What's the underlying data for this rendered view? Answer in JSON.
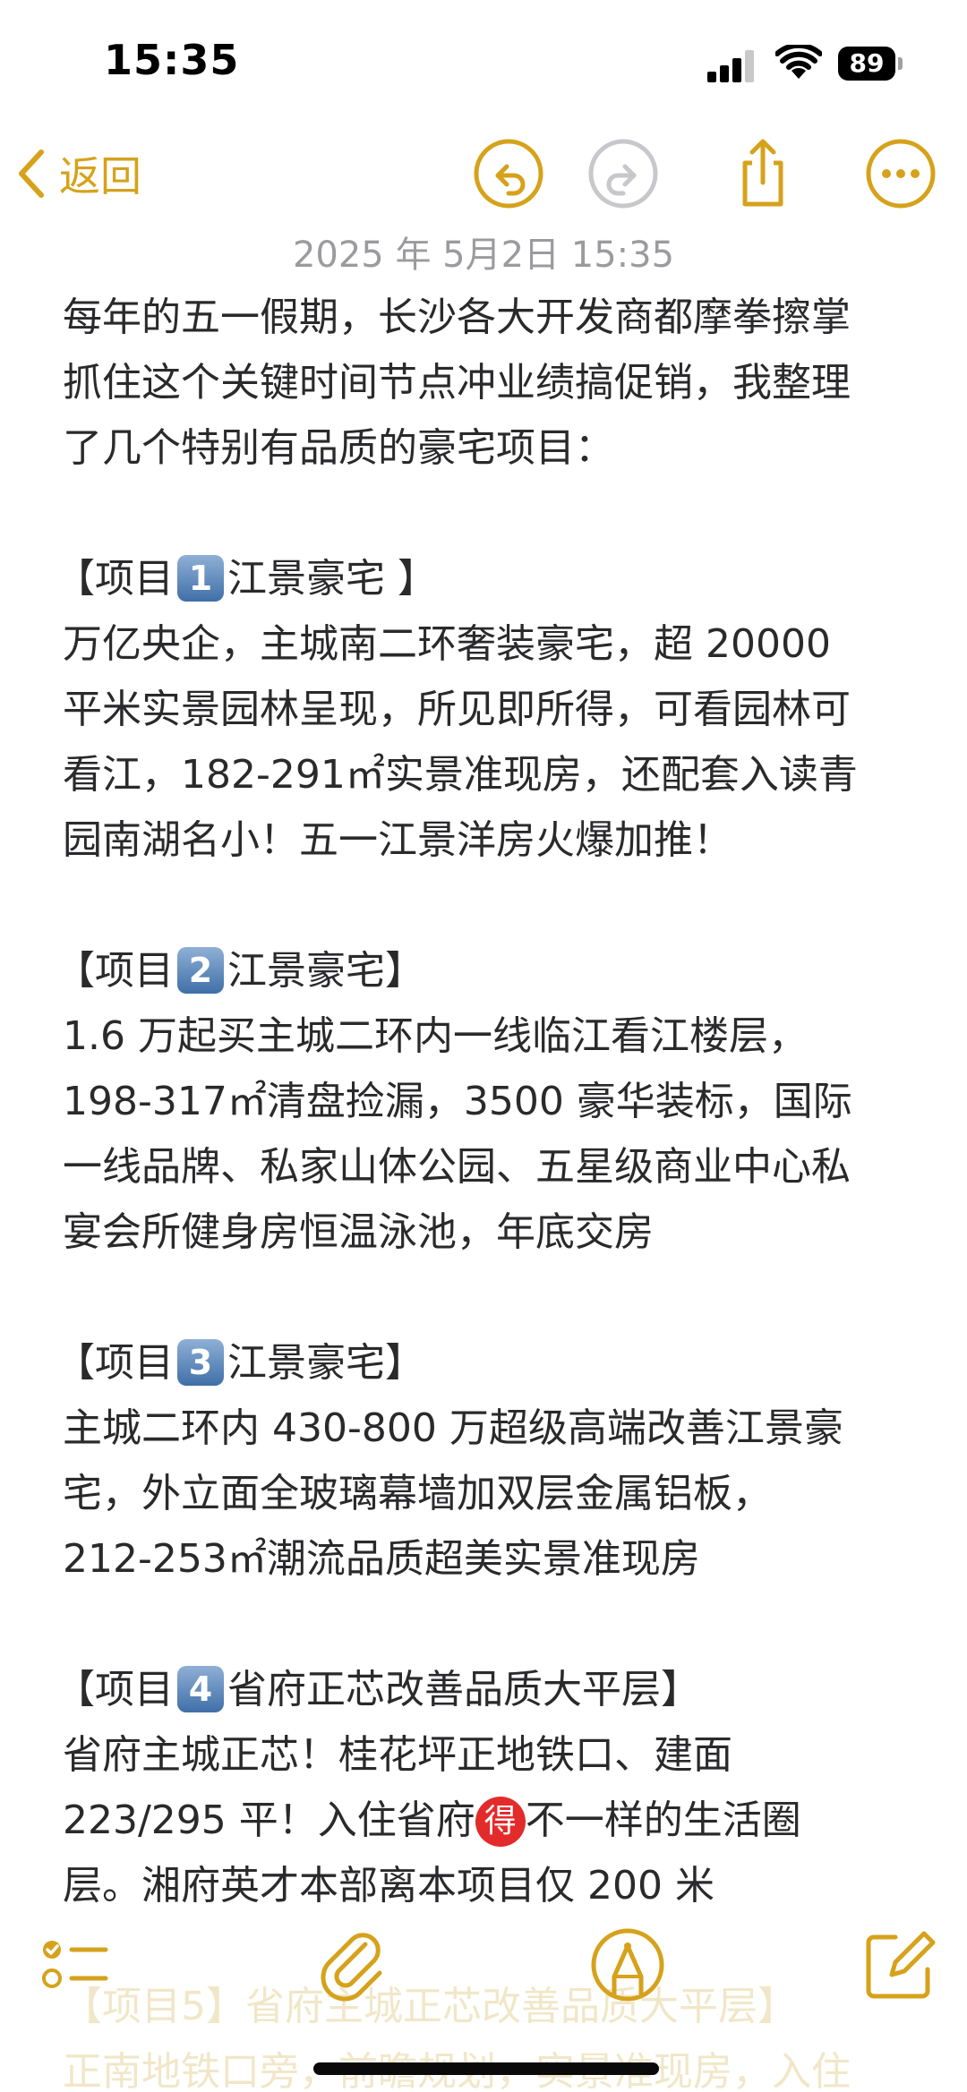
{
  "status_bar": {
    "time": "15:35",
    "battery_level": "89",
    "icons": [
      "signal-icon",
      "wifi-icon",
      "battery-icon"
    ]
  },
  "nav": {
    "back_label": "返回",
    "icons": [
      "undo-icon",
      "redo-icon",
      "share-icon",
      "more-icon"
    ]
  },
  "note": {
    "date": "2025 年 5月2日 15:35",
    "lines": {
      "l1": "每年的五一假期，长沙各大开发商都摩拳擦掌",
      "l2": "抓住这个关键时间节点冲业绩搞促销，我整理",
      "l3": "了几个特别有品质的豪宅项目："
    },
    "projects": [
      {
        "prefix": "【项目",
        "num": "1",
        "title": "江景豪宅 】",
        "lines": [
          "万亿央企，主城南二环奢装豪宅，超 20000",
          "平米实景园林呈现，所见即所得，可看园林可",
          "看江，182-291㎡实景准现房，还配套入读青",
          "园南湖名小！五一江景洋房火爆加推！"
        ]
      },
      {
        "prefix": "【项目",
        "num": "2",
        "title": "江景豪宅】",
        "lines": [
          "1.6 万起买主城二环内一线临江看江楼层，",
          "198-317㎡清盘捡漏，3500 豪华装标，国际",
          "一线品牌、私家山体公园、五星级商业中心私",
          "宴会所健身房恒温泳池，年底交房"
        ]
      },
      {
        "prefix": "【项目",
        "num": "3",
        "title": "江景豪宅】",
        "lines": [
          "主城二环内 430-800 万超级高端改善江景豪",
          "宅，外立面全玻璃幕墙加双层金属铝板，",
          "212-253㎡潮流品质超美实景准现房"
        ]
      },
      {
        "prefix": "【项目",
        "num": "4",
        "title": "省府正芯改善品质大平层】",
        "line1": "省府主城正芯！桂花坪正地铁口、建面",
        "line2_a": "223/295 平！入住省府",
        "badge": "得",
        "line2_b": "不一样的生活圈",
        "line3": "层。湘府英才本部离本项目仅 200 米"
      }
    ],
    "faded_lines": [
      "【项目5】省府主城正芯改善品质大平层】",
      "正南地铁口旁，前瞻规划，实景准现房，入住"
    ]
  },
  "toolbar": {
    "icons": [
      "checklist-icon",
      "attachment-icon",
      "markup-icon",
      "compose-icon"
    ]
  },
  "colors": {
    "accent": "#d6a21b",
    "text": "#2a2a2c",
    "date": "#9b9b9f",
    "disabled": "#c7c7cc"
  }
}
